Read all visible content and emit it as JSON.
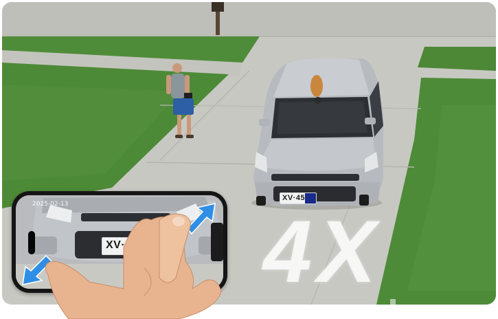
{
  "photo": {
    "zoom_label": "4X",
    "license_plate": "XV·45",
    "phone_plate": "XV·45",
    "phone_timestamp": "2025-02-13",
    "icons": {
      "toolbar": [
        "camera-icon",
        "settings-icon",
        "microphone-icon"
      ],
      "gesture_arrows": [
        "arrow-up-right-icon",
        "arrow-down-left-icon"
      ]
    },
    "colors": {
      "grass": "#4e8a3a",
      "concrete": "#c9c9c4",
      "car_silver": "#b9bcc0",
      "plate_blue": "#1a2a8a",
      "arrow_blue": "#2f8fe6"
    }
  }
}
